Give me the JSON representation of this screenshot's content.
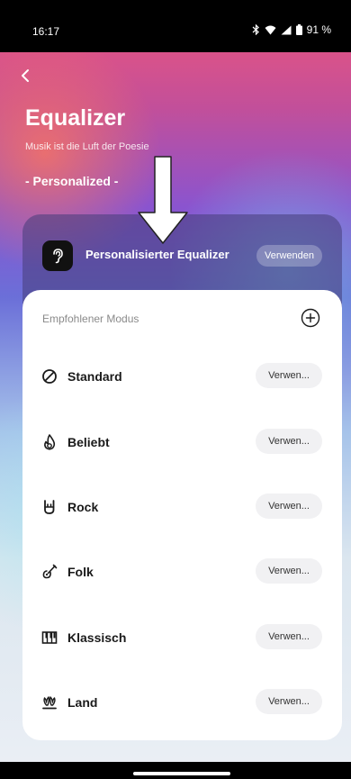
{
  "status": {
    "time": "16:17",
    "battery": "91 %"
  },
  "header": {
    "title": "Equalizer",
    "subtitle": "Musik ist die Luft der Poesie",
    "section": "- Personalized -"
  },
  "personalized": {
    "label": "Personalisierter Equalizer",
    "button": "Verwenden"
  },
  "recommended": {
    "label": "Empfohlener Modus",
    "modes": [
      {
        "label": "Standard",
        "button": "Verwen...",
        "icon": "circle-slash-icon"
      },
      {
        "label": "Beliebt",
        "button": "Verwen...",
        "icon": "flame-icon"
      },
      {
        "label": "Rock",
        "button": "Verwen...",
        "icon": "rock-hand-icon"
      },
      {
        "label": "Folk",
        "button": "Verwen...",
        "icon": "guitar-icon"
      },
      {
        "label": "Klassisch",
        "button": "Verwen...",
        "icon": "piano-icon"
      },
      {
        "label": "Land",
        "button": "Verwen...",
        "icon": "country-icon"
      }
    ]
  }
}
